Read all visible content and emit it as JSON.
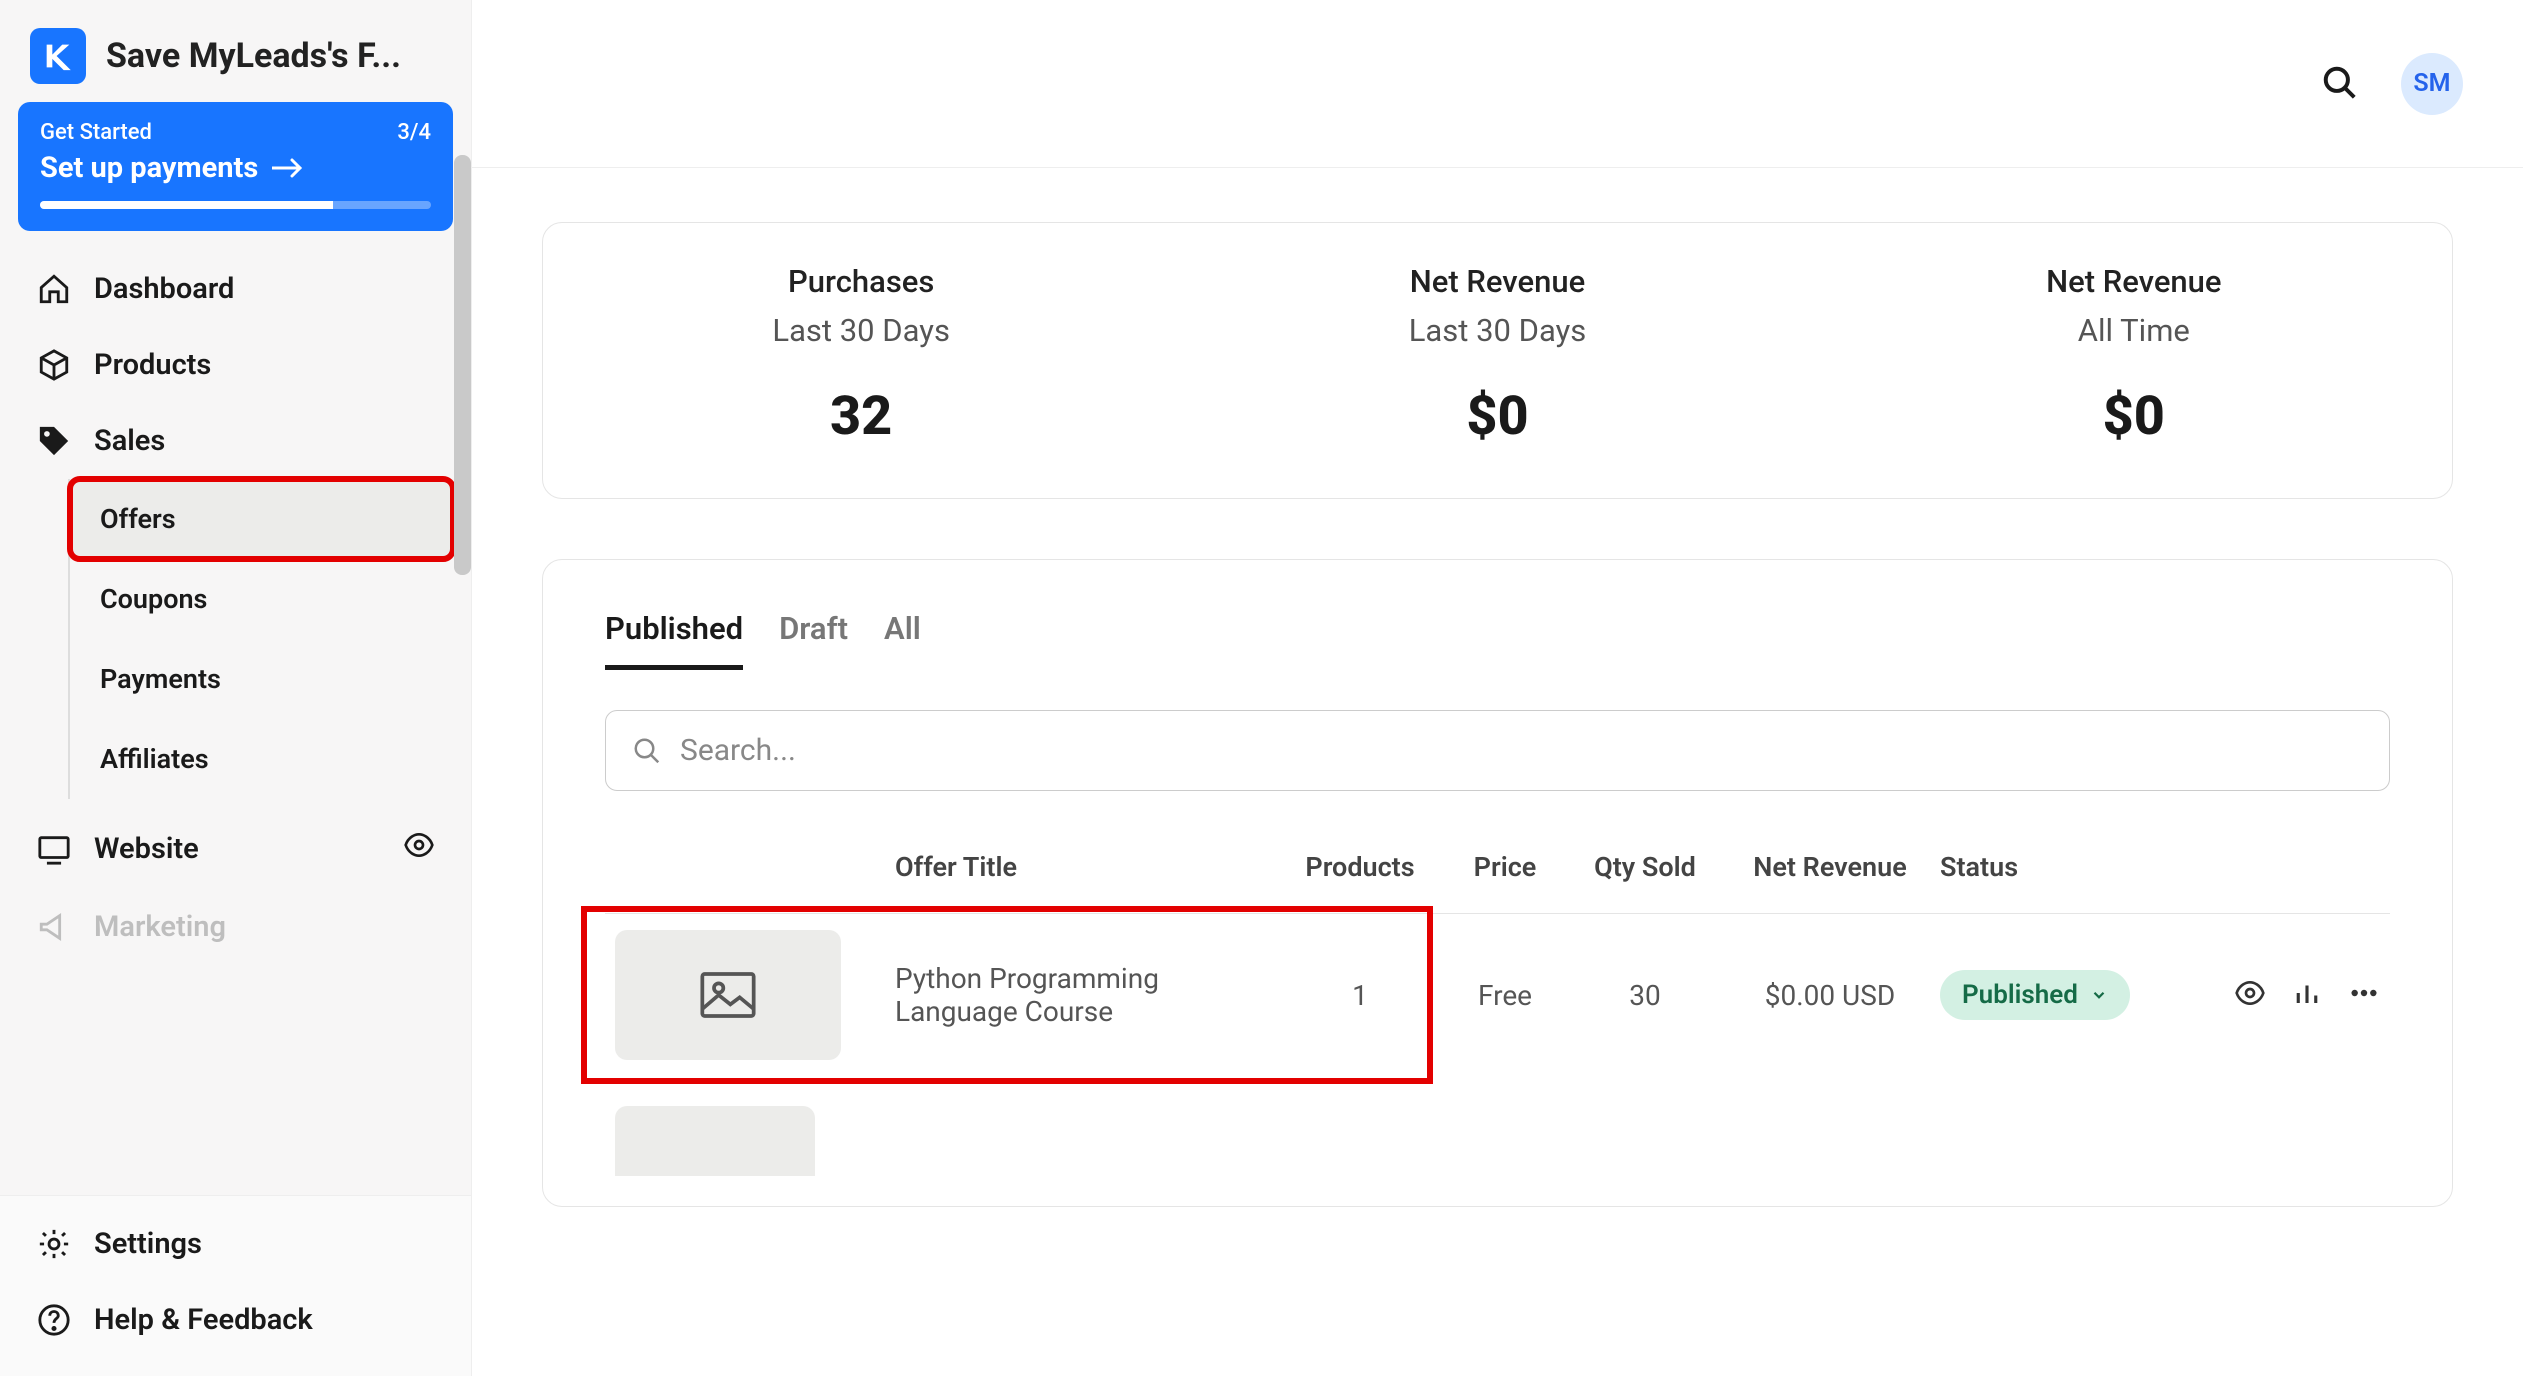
{
  "workspace": {
    "title": "Save MyLeads's F..."
  },
  "getStarted": {
    "label": "Get Started",
    "progressText": "3/4",
    "nextAction": "Set up payments",
    "progressPercent": 75
  },
  "nav": {
    "dashboard": "Dashboard",
    "products": "Products",
    "sales": "Sales",
    "salesSub": {
      "offers": "Offers",
      "coupons": "Coupons",
      "payments": "Payments",
      "affiliates": "Affiliates"
    },
    "website": "Website",
    "marketing": "Marketing",
    "settings": "Settings",
    "help": "Help & Feedback"
  },
  "avatarInitials": "SM",
  "stats": [
    {
      "title": "Purchases",
      "sub": "Last 30 Days",
      "value": "32"
    },
    {
      "title": "Net Revenue",
      "sub": "Last 30 Days",
      "value": "$0"
    },
    {
      "title": "Net Revenue",
      "sub": "All Time",
      "value": "$0"
    }
  ],
  "tabs": {
    "published": "Published",
    "draft": "Draft",
    "all": "All"
  },
  "searchPlaceholder": "Search...",
  "columns": {
    "title": "Offer Title",
    "products": "Products",
    "price": "Price",
    "qty": "Qty Sold",
    "rev": "Net Revenue",
    "status": "Status"
  },
  "rows": [
    {
      "title": "Python Programming Language Course",
      "products": "1",
      "price": "Free",
      "qty": "30",
      "rev": "$0.00 USD",
      "status": "Published"
    }
  ]
}
